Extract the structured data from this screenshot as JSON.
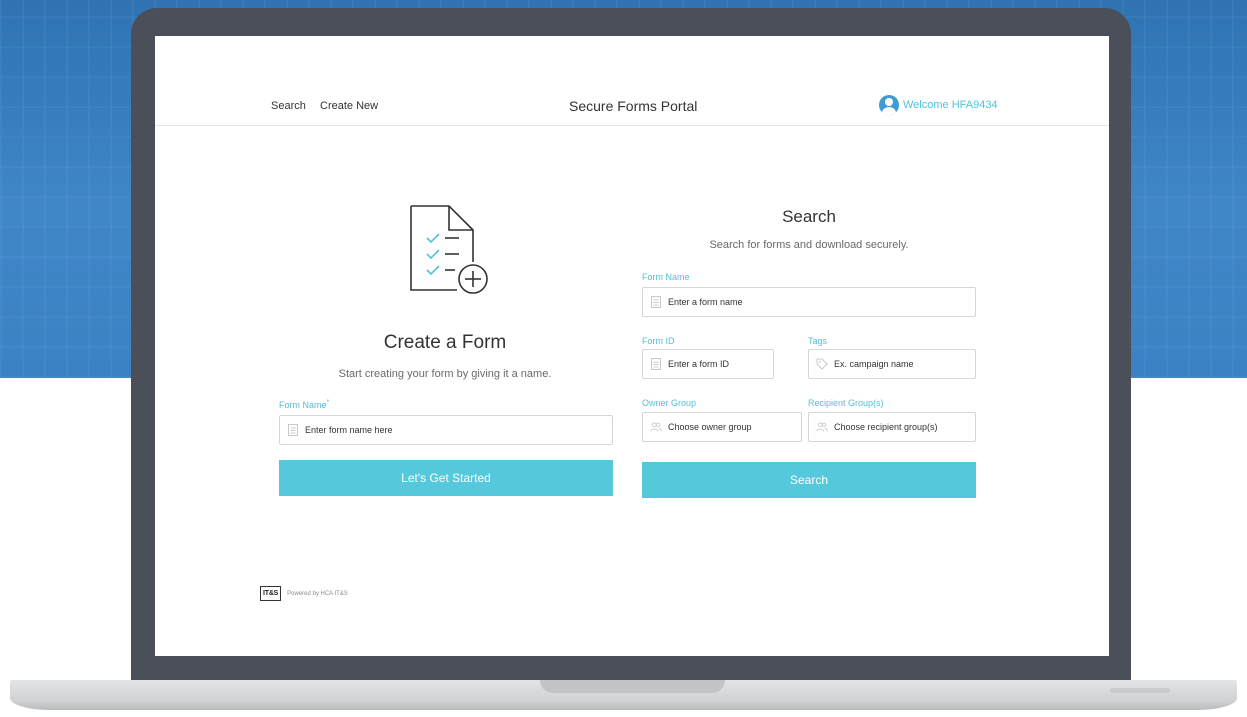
{
  "nav": {
    "search": "Search",
    "create_new": "Create New",
    "title": "Secure Forms Portal",
    "welcome": "Welcome HFA9434"
  },
  "create": {
    "title": "Create a Form",
    "subtitle": "Start creating your form by giving it a name.",
    "form_name_label": "Form Name",
    "required_mark": "*",
    "form_name_placeholder": "Enter form name here",
    "button": "Let's Get Started"
  },
  "search": {
    "title": "Search",
    "subtitle": "Search for forms and download securely.",
    "form_name_label": "Form Name",
    "form_name_placeholder": "Enter a form name",
    "form_id_label": "Form ID",
    "form_id_placeholder": "Enter a form ID",
    "tags_label": "Tags",
    "tags_placeholder": "Ex. campaign name",
    "owner_group_label": "Owner Group",
    "owner_group_placeholder": "Choose owner group",
    "recipient_group_label": "Recipient Group(s)",
    "recipient_group_placeholder": "Choose recipient group(s)",
    "button": "Search"
  },
  "footer": {
    "logo_text": "IT&S",
    "powered_by": "Powered by HCA IT&S"
  },
  "colors": {
    "accent": "#56c8dc",
    "label": "#52c0d8",
    "bezel": "#4a4f59",
    "background_blue": "#3a82c3"
  },
  "icons": {
    "form_add": "form-add-icon",
    "avatar": "user-avatar-icon",
    "document": "document-icon",
    "tag": "tag-icon",
    "people": "people-icon"
  }
}
